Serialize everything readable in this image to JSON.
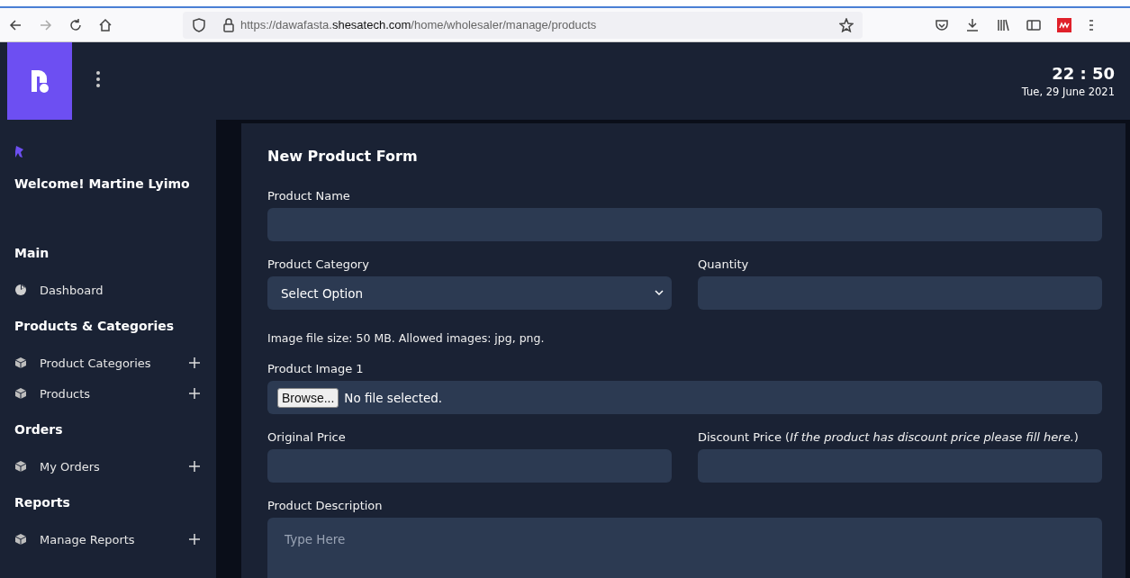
{
  "browser": {
    "url": "https://dawafasta.**shesatech.com**/home/wholesaler/manage/products"
  },
  "header": {
    "time": "22 : 50",
    "date": "Tue, 29 June 2021"
  },
  "sidebar": {
    "welcome": "Welcome! Martine Lyimo",
    "sections": [
      {
        "title": "Main",
        "items": [
          {
            "label": "Dashboard",
            "kind": "chart",
            "expandable": false
          }
        ]
      },
      {
        "title": "Products & Categories",
        "items": [
          {
            "label": "Product Categories",
            "kind": "cube",
            "expandable": true
          },
          {
            "label": "Products",
            "kind": "cube",
            "expandable": true
          }
        ]
      },
      {
        "title": "Orders",
        "items": [
          {
            "label": "My Orders",
            "kind": "cube",
            "expandable": true
          }
        ]
      },
      {
        "title": "Reports",
        "items": [
          {
            "label": "Manage Reports",
            "kind": "cube",
            "expandable": true
          }
        ]
      }
    ]
  },
  "form": {
    "title": "New Product Form",
    "rows": [
      [
        {
          "kind": "text",
          "label": "Product Name"
        }
      ],
      [
        {
          "kind": "select",
          "label": "Product Category",
          "value": "Select Option"
        },
        {
          "kind": "text",
          "label": "Quantity"
        }
      ],
      [
        {
          "kind": "note",
          "label": "Image file size: 50 MB. Allowed images: jpg, png."
        }
      ],
      [
        {
          "kind": "file",
          "label": "Product Image 1",
          "button": "Browse...",
          "status": "No file selected."
        }
      ],
      [
        {
          "kind": "text",
          "label": "Original Price"
        },
        {
          "kind": "text",
          "label": "Discount Price (*If the product has discount price please fill here.*)"
        }
      ],
      [
        {
          "kind": "textarea",
          "label": "Product Description",
          "placeholder": "Type Here"
        }
      ]
    ]
  }
}
